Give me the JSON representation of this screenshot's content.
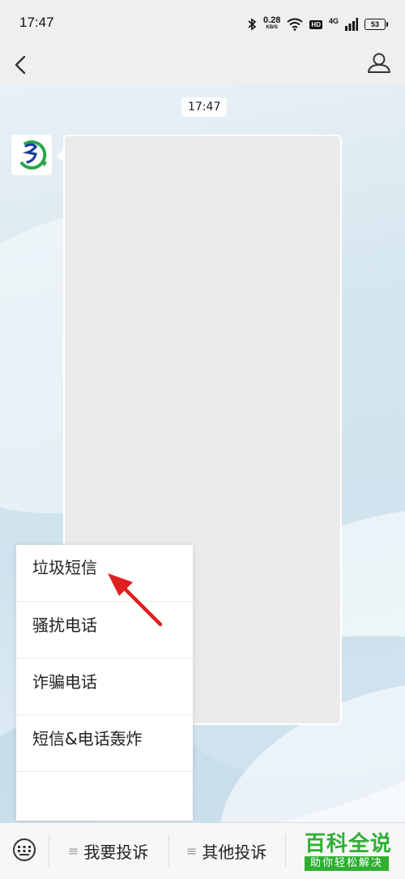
{
  "status_bar": {
    "time": "17:47",
    "net_speed": "0.28",
    "net_speed_unit": "KB/S",
    "hd_badge": "HD",
    "network_type": "4G",
    "battery": "53"
  },
  "chat": {
    "timestamp": "17:47"
  },
  "popup_menu": {
    "items": [
      "垃圾短信",
      "骚扰电话",
      "诈骗电话",
      "短信&电话轰炸"
    ]
  },
  "bottom_bar": {
    "tabs": [
      "我要投诉",
      "其他投诉"
    ]
  },
  "watermark": {
    "title": "百科全说",
    "subtitle": "助你轻松解决"
  },
  "colors": {
    "accent_green": "#2db032",
    "arrow_red": "#e02020",
    "avatar_blue": "#1f3f9c",
    "avatar_green": "#2aa64a"
  },
  "icons": [
    "bluetooth-icon",
    "wifi-icon",
    "signal-icon",
    "battery-icon",
    "back-arrow-icon",
    "person-icon",
    "keyboard-icon",
    "menu-lines-icon"
  ]
}
